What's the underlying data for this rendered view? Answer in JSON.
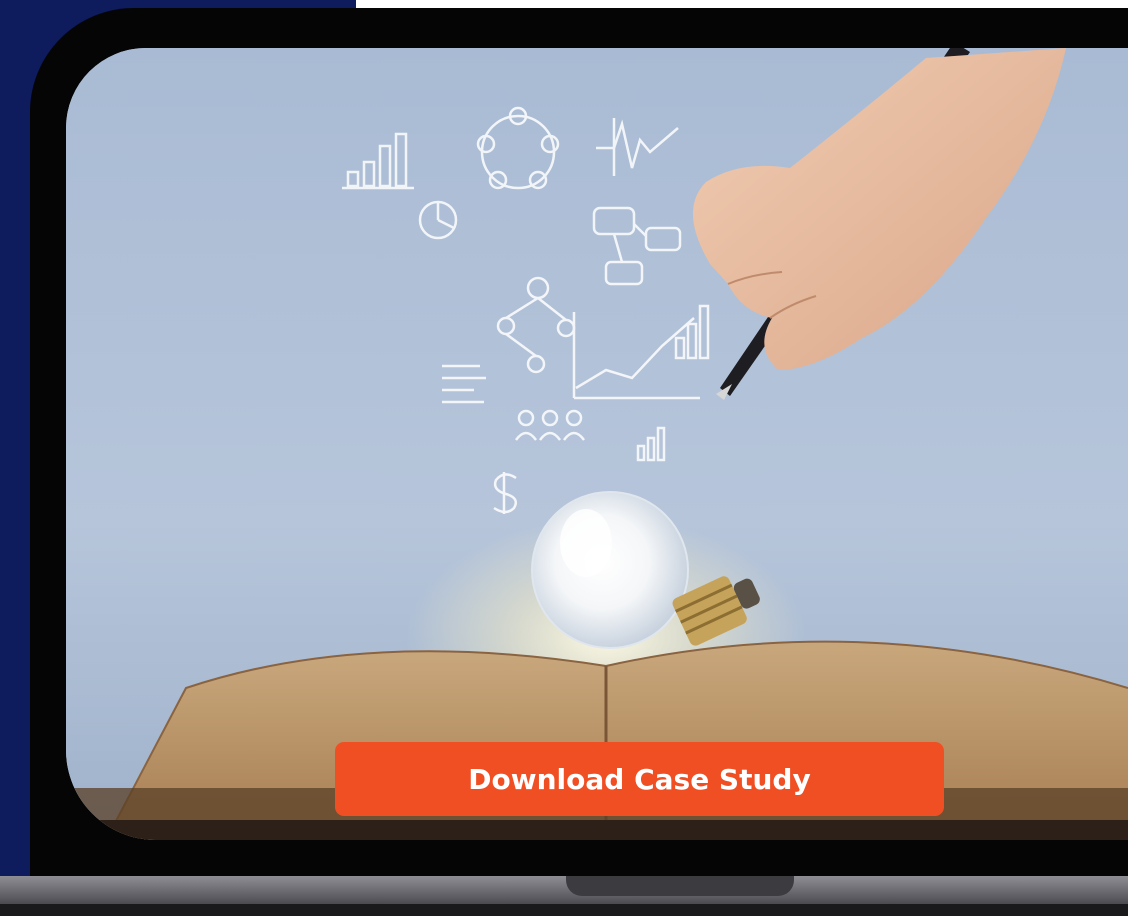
{
  "cta": {
    "label": "Download Case Study",
    "color": "#f04f23"
  },
  "colors": {
    "navy": "#0e1b5c",
    "frame": "#050505",
    "screen_bg": "#b3c2d8"
  },
  "hero_image": {
    "content": "open book with glowing lightbulb, hand with pen drawing business sketches",
    "icons": [
      "bar-chart-sketch",
      "team-circle-sketch",
      "heartbeat-sketch",
      "lightbulb-icon",
      "open-book",
      "pen-icon"
    ]
  }
}
